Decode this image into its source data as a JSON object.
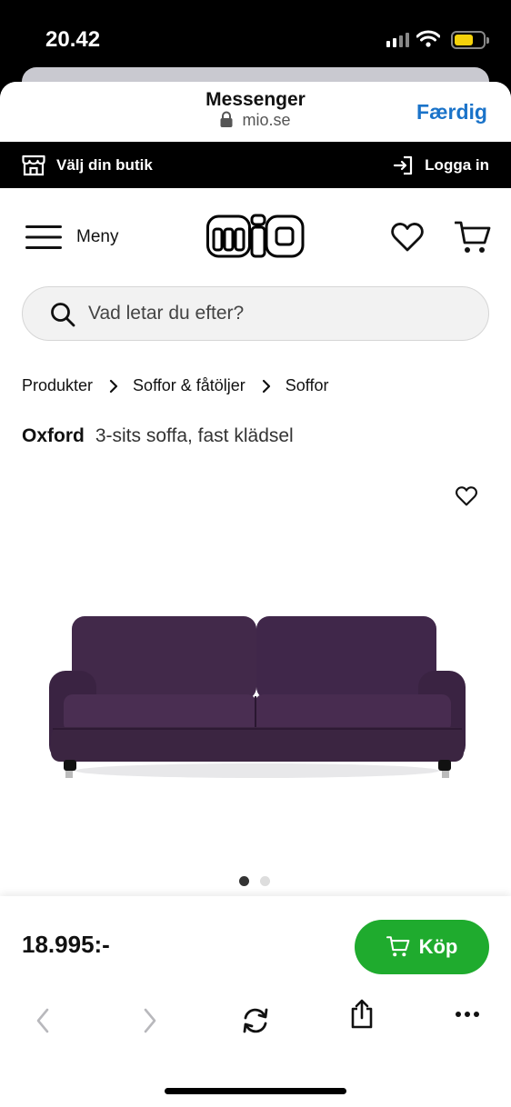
{
  "status": {
    "time": "20.42"
  },
  "browser": {
    "title": "Messenger",
    "domain": "mio.se",
    "done_label": "Færdig"
  },
  "topbar": {
    "store_label": "Välj din butik",
    "login_label": "Logga in"
  },
  "nav": {
    "menu_label": "Meny",
    "logo_text": "mio"
  },
  "search": {
    "placeholder": "Vad letar du efter?"
  },
  "breadcrumb": [
    "Produkter",
    "Soffor & fåtöljer",
    "Soffor"
  ],
  "product": {
    "brand": "Oxford",
    "description": "3-sits soffa, fast klädsel",
    "price": "18.995:-",
    "buy_label": "Köp",
    "image_count": 2,
    "active_image": 1,
    "fabric_color": "#3b2541"
  },
  "colors": {
    "accent": "#1a73c9",
    "buy": "#1fab2e",
    "topbar": "#000000"
  },
  "toolbar": [
    "back-icon",
    "forward-icon",
    "reload-icon",
    "share-icon",
    "more-icon"
  ]
}
